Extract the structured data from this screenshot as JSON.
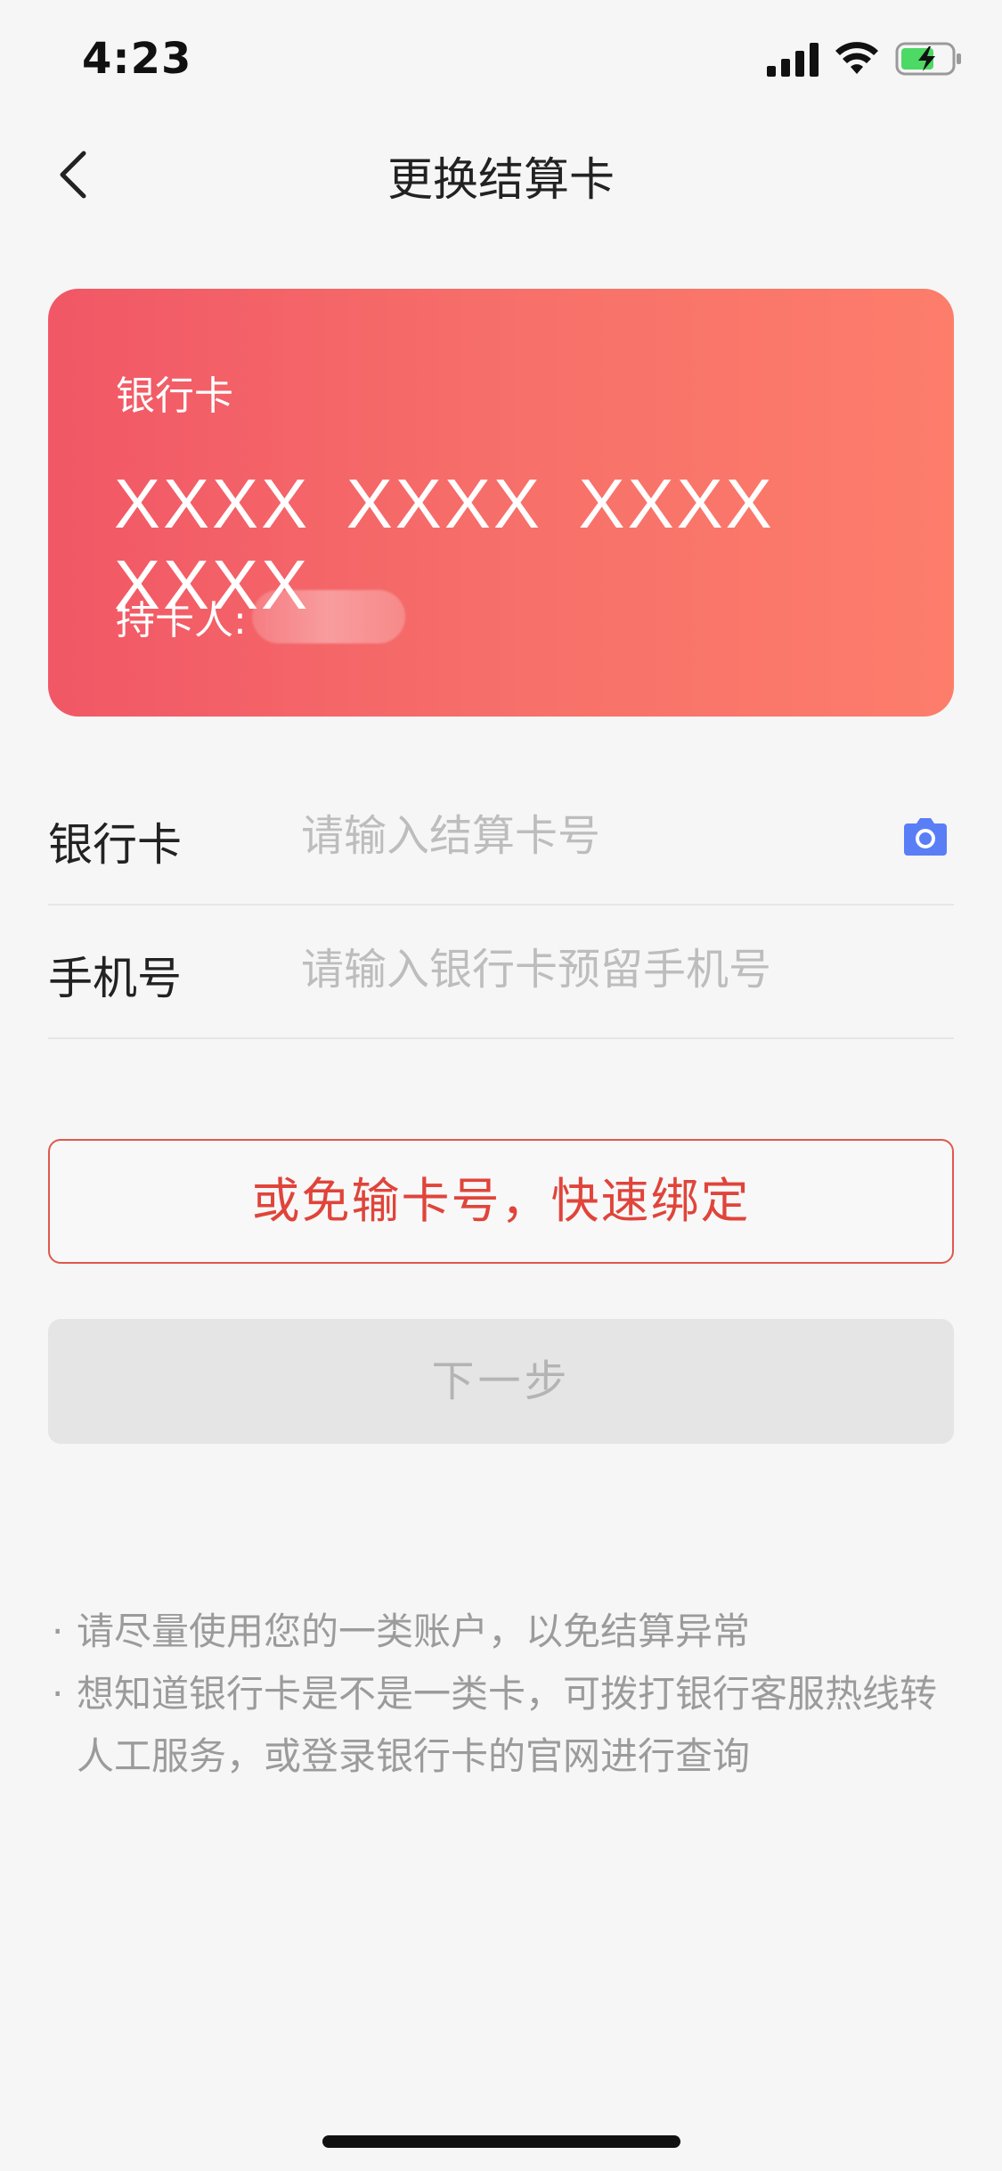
{
  "status_bar": {
    "time": "4:23",
    "icons": [
      "cellular-signal-icon",
      "wifi-icon",
      "battery-charging-icon"
    ],
    "battery_color": "#4cd964"
  },
  "nav": {
    "back_icon": "chevron-left-icon",
    "title": "更换结算卡"
  },
  "card": {
    "type_label": "银行卡",
    "number": "XXXX XXXX XXXX XXXX",
    "holder_label": "持卡人:",
    "holder_value": "",
    "gradient": [
      "#f15766",
      "#fd7d6b"
    ]
  },
  "form": {
    "card_field": {
      "label": "银行卡",
      "value": "",
      "placeholder": "请输入结算卡号",
      "scan_icon": "camera-icon",
      "scan_icon_color": "#5a7ef6"
    },
    "phone_field": {
      "label": "手机号",
      "value": "",
      "placeholder": "请输入银行卡预留手机号"
    }
  },
  "actions": {
    "quick_bind": "或免输卡号，快速绑定",
    "next": "下一步",
    "accent_color": "#e0443a"
  },
  "tips": {
    "bullet": "·",
    "items": [
      "请尽量使用您的一类账户，以免结算异常",
      "想知道银行卡是不是一类卡，可拨打银行客服热线转人工服务，或登录银行卡的官网进行查询"
    ]
  }
}
